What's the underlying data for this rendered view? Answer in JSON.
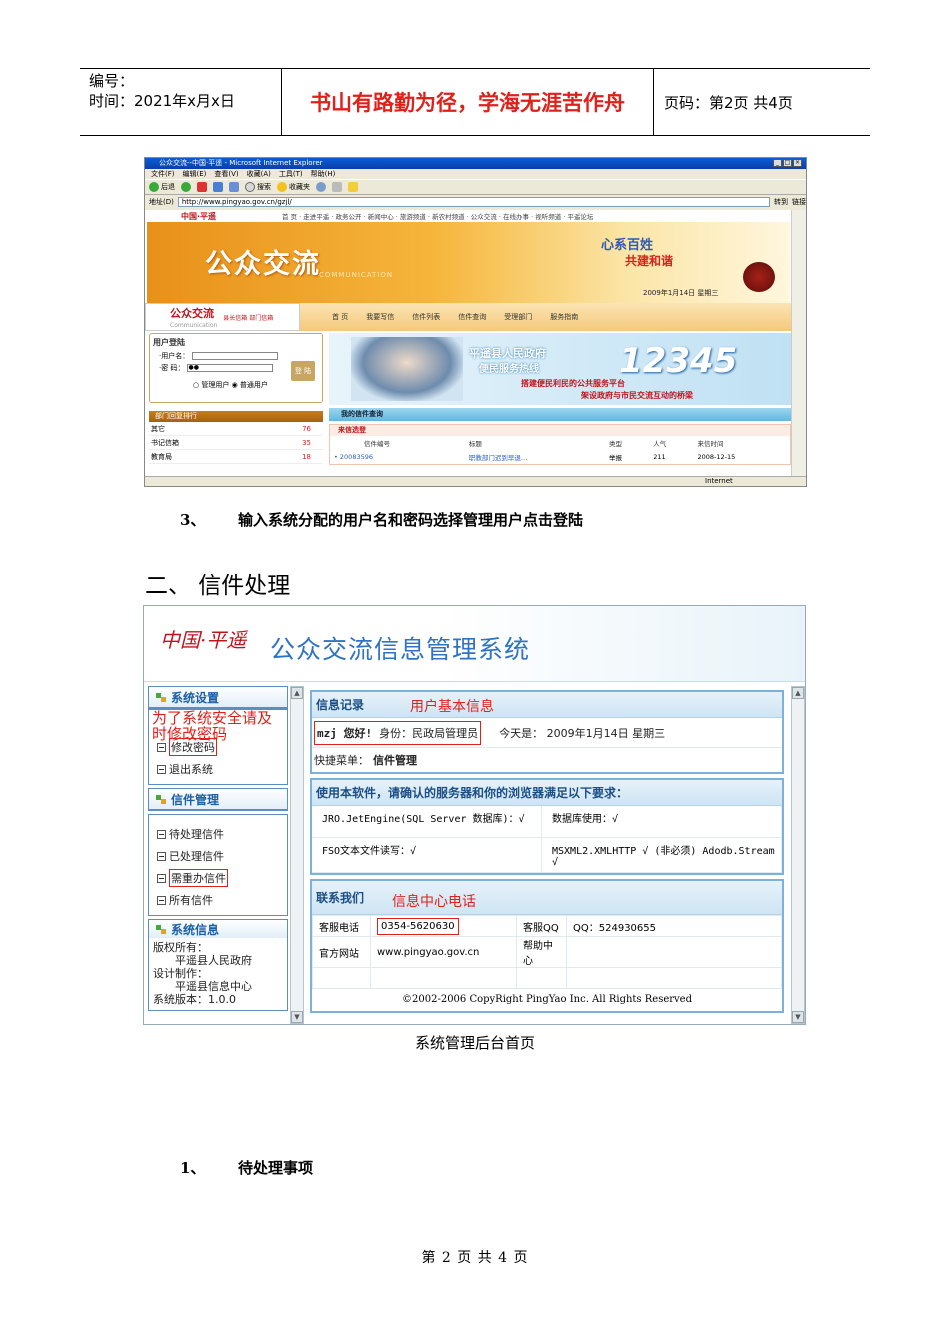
{
  "header": {
    "number_label": "编号：",
    "time_label": "时间：2021年x月x日",
    "motto": "书山有路勤为径，学海无涯苦作舟",
    "page_label": "页码：第2页  共4页"
  },
  "browser": {
    "title": "公众交流--中国·平遥 - Microsoft Internet Explorer",
    "menus": [
      "文件(F)",
      "编辑(E)",
      "查看(V)",
      "收藏(A)",
      "工具(T)",
      "帮助(H)"
    ],
    "toolbar": [
      "后退",
      "搜索",
      "收藏夹"
    ],
    "address_label": "地址(D)",
    "address": "http://www.pingyao.gov.cn/gzjl/",
    "go_label": "转到",
    "links_label": "链接",
    "status_zone": "Internet",
    "site_logo": "中国·平遥",
    "site_nav": "首 页 · 走进平遥 · 政务公开 · 新闻中心 · 旅游频道 · 新农村频道 · 公众交流 · 在线办事 · 视听频道 · 平遥论坛",
    "banner_title": "公众交流",
    "banner_sub": "COMMUNICATION",
    "slogan1": "心系百姓",
    "slogan2": "共建和谐",
    "banner_date": "2009年1月14日  星期三",
    "brand": "公众交流",
    "brand_sub": "Communication",
    "brand_side": "县长信箱 部门信箱",
    "menu_items": [
      "首 页",
      "我要写信",
      "信件列表",
      "信件查询",
      "受理部门",
      "服务指南"
    ],
    "login_title": "用户登陆",
    "username_label": "·用户名：",
    "password_label": "·密  码：",
    "password_value": "●●",
    "login_button": "登 陆",
    "radio_admin": "管理用户",
    "radio_normal": "普通用户",
    "rank_title": "部门回复排行",
    "rank": [
      {
        "name": "其它",
        "count": "76"
      },
      {
        "name": "书记信箱",
        "count": "35"
      },
      {
        "name": "教育局",
        "count": "18"
      }
    ],
    "hotline1": "平遥县人民政府",
    "hotline2": "便民服务热线",
    "hotline_number": "12345",
    "hotline3": "搭建便民利民的公共服务平台",
    "hotline4": "架设政府与市民交流互动的桥梁",
    "my_letters": "我的信件查询",
    "letters_tab": "来信选登",
    "letter_headers": [
      "信件编号",
      "标题",
      "类型",
      "人气",
      "来信时间"
    ],
    "letter_row": [
      "20083596",
      "职教部门迟到早退…",
      "举报",
      "211",
      "2008-12-15"
    ]
  },
  "step3": {
    "num": "3、",
    "text": "输入系统分配的用户名和密码选择管理用户点击登陆"
  },
  "section2": "二、  信件处理",
  "admin": {
    "logo": "中国·平遥",
    "title": "公众交流信息管理系统",
    "sys_settings": "系统设置",
    "sys_items": [
      "修改密码",
      "退出系统"
    ],
    "note": "为了系统安全请及时修改密码",
    "letter_mgmt": "信件管理",
    "letter_items": [
      "待处理信件",
      "已处理信件",
      "需重办信件",
      "所有信件"
    ],
    "sys_info": "系统信息",
    "copyright_label": "版权所有：",
    "copyright_owner": "平遥县人民政府",
    "design_label": "设计制作：",
    "design_owner": "平遥县信息中心",
    "version": "系统版本：1.0.0",
    "record_title": "信息记录",
    "record_tag": "用户基本信息",
    "user": "mzj 您好!",
    "identity": "身份：民政局管理员",
    "today": "今天是： 2009年1月14日 星期三",
    "quick_label": "快捷菜单：",
    "quick_value": "信件管理",
    "req_title": "使用本软件，请确认的服务器和你的浏览器满足以下要求：",
    "req_cells": [
      "JRO.JetEngine(SQL Server 数据库)：√",
      "数据库使用：√",
      "FSO文本文件读写：√",
      "MSXML2.XMLHTTP √ (非必须) Adodb.Stream √"
    ],
    "contact_title": "联系我们",
    "contact_tag": "信息中心电话",
    "phone_label": "客服电话",
    "phone": "0354-5620630",
    "qq_label": "客服QQ",
    "qq": "QQ：524930655",
    "site_label": "官方网站",
    "site": "www.pingyao.gov.cn",
    "help": "帮助中心",
    "footer": "©2002-2006 CopyRight PingYao Inc.    All Rights Reserved"
  },
  "caption": "系统管理后台首页",
  "step1": {
    "num": "1、",
    "text": "待处理事项"
  },
  "footer": "第 2 页 共 4 页"
}
